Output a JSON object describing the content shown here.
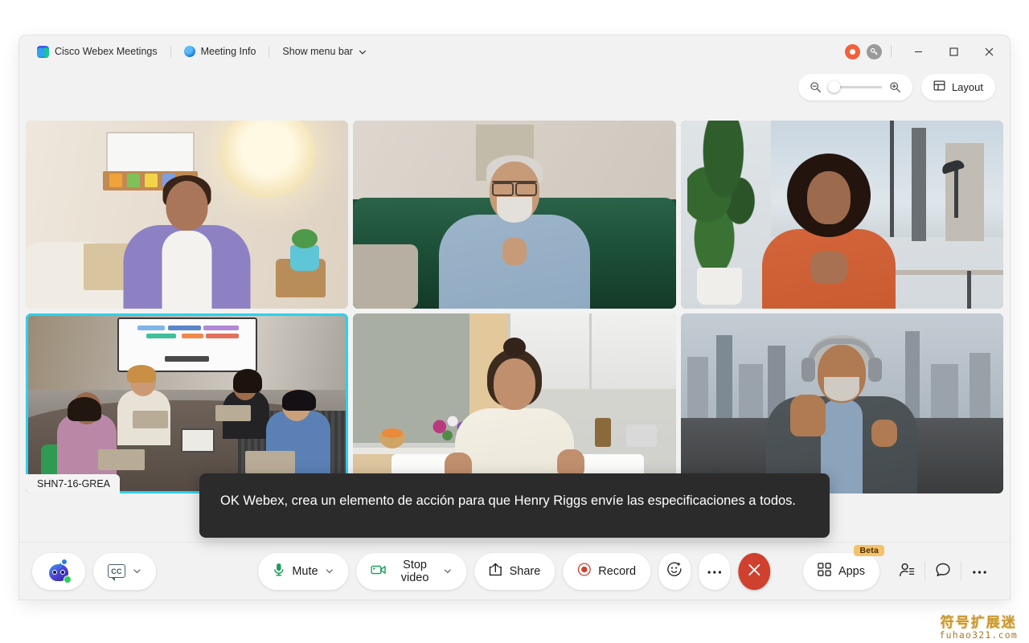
{
  "app": {
    "title": "Cisco Webex Meetings",
    "meeting_info": "Meeting Info",
    "show_menu_bar": "Show menu bar"
  },
  "titlebar_icons": {
    "webex_logo": "webex-logo-icon",
    "meeting_info_icon": "shield-info-icon",
    "menu_chevron": "chevron-down-icon",
    "recording_indicator": "recording-dot-icon",
    "encryption_badge": "key-icon",
    "minimize": "minimize-icon",
    "maximize": "maximize-icon",
    "close": "close-icon"
  },
  "toolbar": {
    "zoom_out_label": "zoom-out-icon",
    "zoom_in_label": "zoom-in-icon",
    "zoom_value": 0,
    "layout_label": "Layout",
    "layout_icon": "grid-layout-icon"
  },
  "grid": {
    "participants": [
      {
        "id": "p1",
        "scene": "bedroom-purple-shirt",
        "active_speaker": false,
        "name": ""
      },
      {
        "id": "p2",
        "scene": "green-couch-glasses",
        "active_speaker": false,
        "name": ""
      },
      {
        "id": "p3",
        "scene": "office-orange-top",
        "active_speaker": false,
        "name": ""
      },
      {
        "id": "p4",
        "scene": "conference-room",
        "active_speaker": true,
        "name": "SHN7-16-GREA"
      },
      {
        "id": "p5",
        "scene": "kitchen-cream-blouse",
        "active_speaker": false,
        "name": ""
      },
      {
        "id": "p6",
        "scene": "skyline-headphones",
        "active_speaker": false,
        "name": ""
      }
    ]
  },
  "caption": {
    "text": "OK Webex, crea un elemento de acción para que Henry Riggs envíe las especificaciones a todos."
  },
  "controls": {
    "ai_assistant": "webex-ai-assistant-icon",
    "closed_captions": "CC",
    "mute": "Mute",
    "stop_video": "Stop video",
    "share": "Share",
    "record": "Record",
    "reactions": "reactions-smiley-icon",
    "more_options": "more-options-icon",
    "end_meeting": "end-meeting-icon",
    "apps": "Apps",
    "apps_badge": "Beta",
    "participants": "participants-icon",
    "chat": "chat-bubble-icon",
    "more_right": "more-options-icon"
  },
  "colors": {
    "active_speaker_border": "#2ad2ee",
    "end_call_red": "#d0402f",
    "record_red": "#d0402f",
    "mic_green": "#1a9d5a",
    "beta_badge": "#f5c26b",
    "caption_bg": "#2b2b2b",
    "window_bg": "#f2f2f2"
  },
  "watermark": {
    "cn": "符号扩展迷",
    "en": "fuhao321.com"
  }
}
